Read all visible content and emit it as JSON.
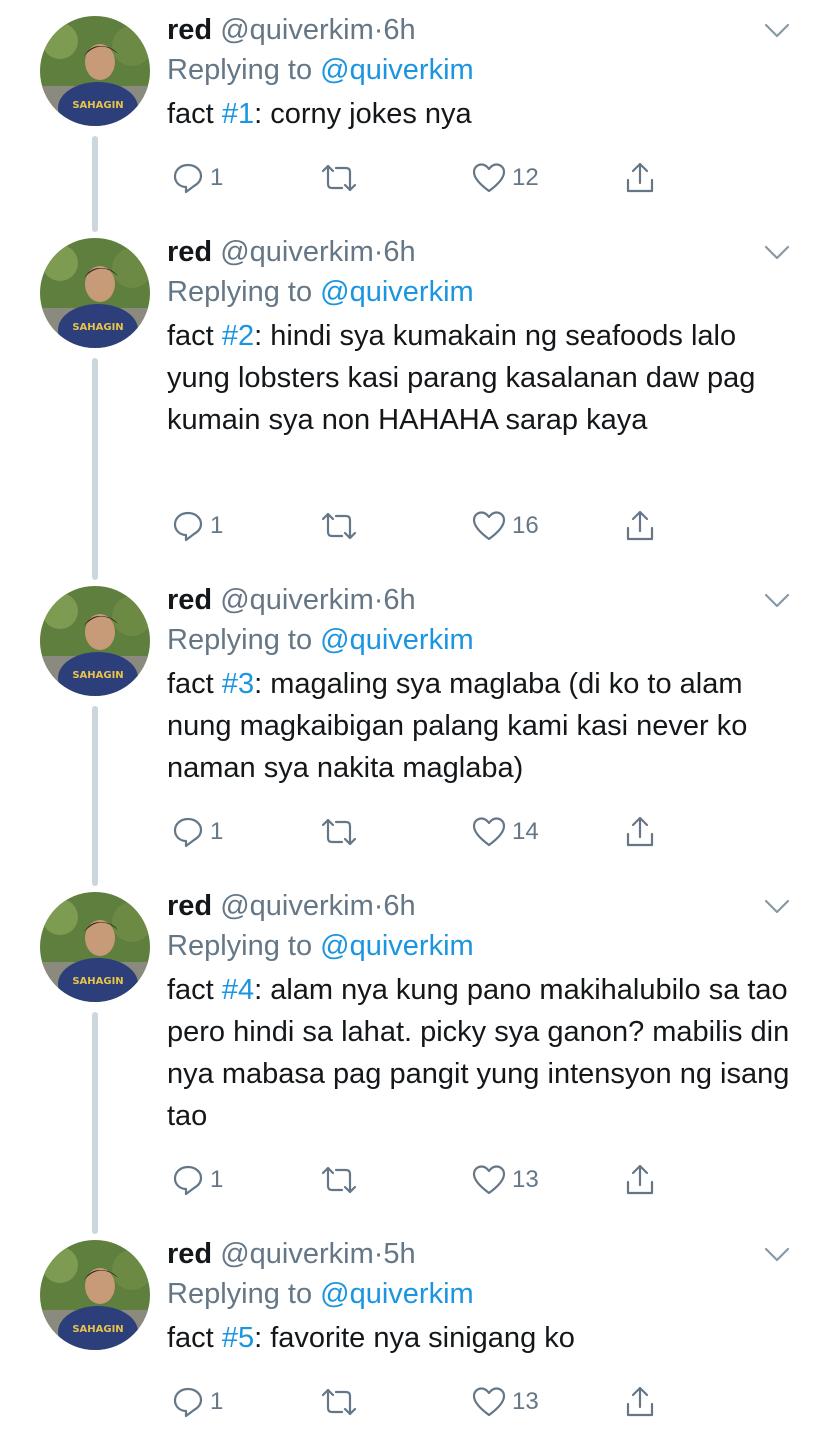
{
  "tweets": [
    {
      "name": "red",
      "handle": "@quiverkim",
      "separator": "·",
      "time": "6h",
      "replying_prefix": "Replying to ",
      "replying_to": "@quiverkim",
      "text_prefix": "fact ",
      "hashtag": "#1",
      "text_rest": ": corny jokes nya",
      "replies": "1",
      "likes": "12"
    },
    {
      "name": "red",
      "handle": "@quiverkim",
      "separator": "·",
      "time": "6h",
      "replying_prefix": "Replying to ",
      "replying_to": "@quiverkim",
      "text_prefix": "fact ",
      "hashtag": "#2",
      "text_rest": ": hindi sya kumakain ng seafoods lalo yung lobsters kasi parang kasalanan daw pag kumain sya non HAHAHA sarap kaya",
      "replies": "1",
      "likes": "16"
    },
    {
      "name": "red",
      "handle": "@quiverkim",
      "separator": "·",
      "time": "6h",
      "replying_prefix": "Replying to ",
      "replying_to": "@quiverkim",
      "text_prefix": "fact ",
      "hashtag": "#3",
      "text_rest": ": magaling sya maglaba (di ko to alam nung magkaibigan palang kami kasi never ko naman sya nakita maglaba)",
      "replies": "1",
      "likes": "14"
    },
    {
      "name": "red",
      "handle": "@quiverkim",
      "separator": "·",
      "time": "6h",
      "replying_prefix": "Replying to ",
      "replying_to": "@quiverkim",
      "text_prefix": "fact ",
      "hashtag": "#4",
      "text_rest": ": alam nya kung pano makihalubilo sa tao pero hindi sa lahat. picky sya ganon? mabilis din nya mabasa pag pangit yung intensyon ng isang tao",
      "replies": "1",
      "likes": "13"
    },
    {
      "name": "red",
      "handle": "@quiverkim",
      "separator": "·",
      "time": "5h",
      "replying_prefix": "Replying to ",
      "replying_to": "@quiverkim",
      "text_prefix": "fact ",
      "hashtag": "#5",
      "text_rest": ": favorite nya sinigang ko",
      "replies": "1",
      "likes": "13"
    }
  ],
  "icons": {
    "reply": "reply-icon",
    "retweet": "retweet-icon",
    "like": "heart-icon",
    "share": "share-icon",
    "more": "chevron-down-icon"
  },
  "colors": {
    "text": "#14171a",
    "secondary": "#657786",
    "link": "#1b95e0",
    "thread_line": "#ccd6dd"
  }
}
